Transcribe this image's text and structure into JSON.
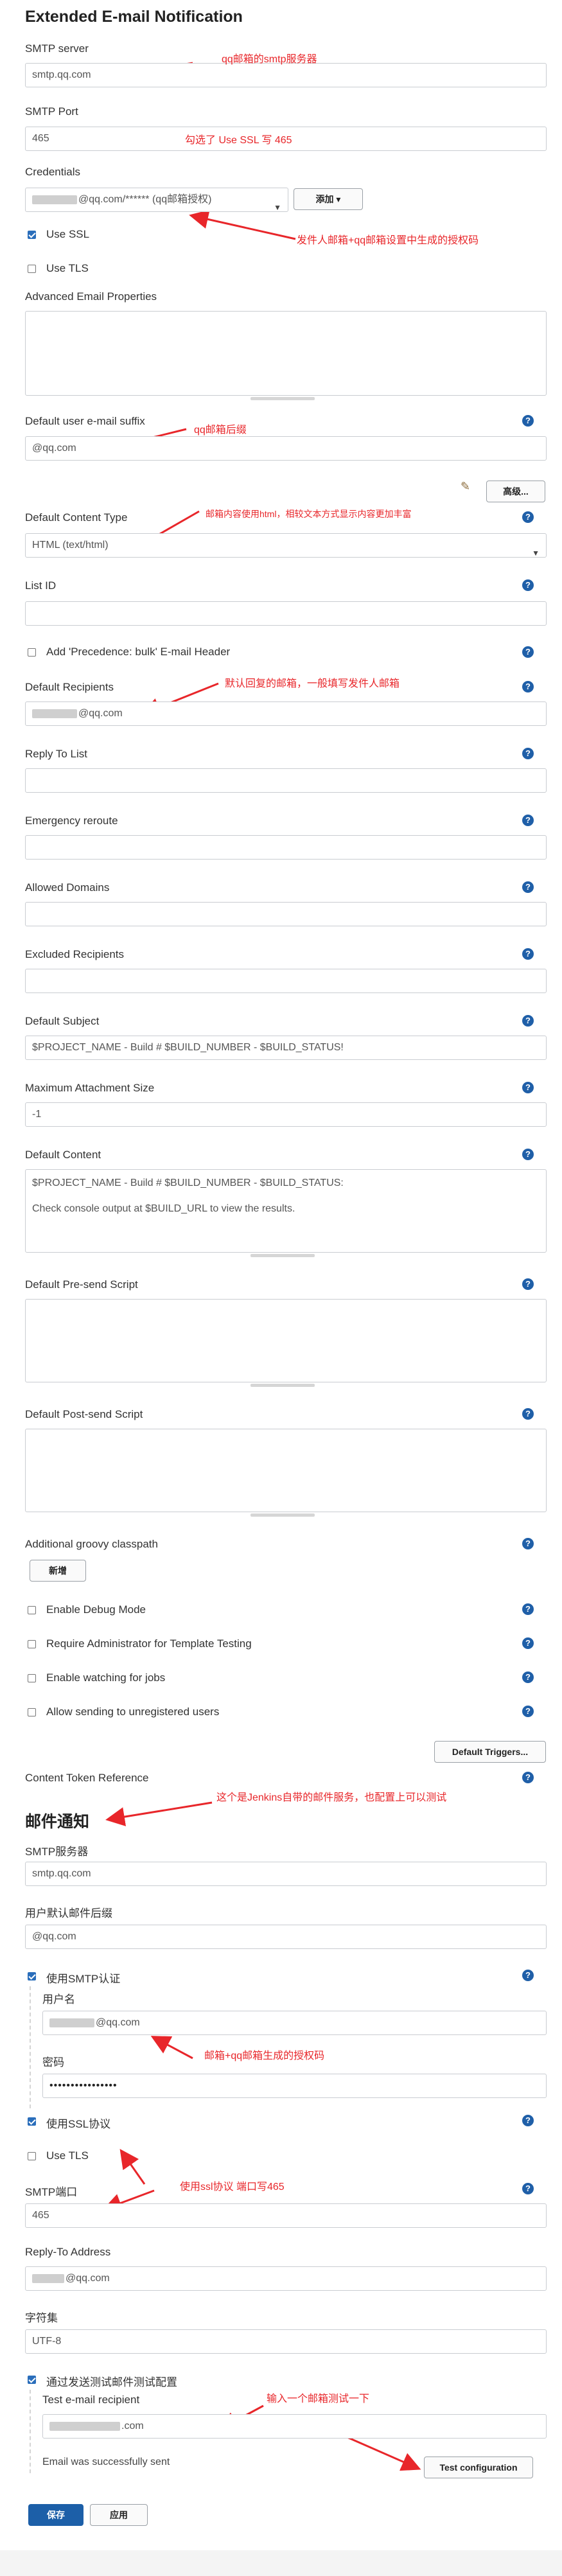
{
  "title": "Extended E-mail Notification",
  "smtp_server": {
    "label": "SMTP server",
    "value": "smtp.qq.com",
    "note": "qq邮箱的smtp服务器"
  },
  "smtp_port": {
    "label": "SMTP Port",
    "value": "465",
    "note": "勾选了 Use SSL 写 465"
  },
  "credentials": {
    "label": "Credentials",
    "value": "@qq.com/****** (qq邮箱授权)",
    "add_button": "添加",
    "note": "发件人邮箱+qq邮箱设置中生成的授权码"
  },
  "use_ssl": {
    "label": "Use SSL",
    "checked": true
  },
  "use_tls": {
    "label": "Use TLS",
    "checked": false
  },
  "advanced_props": {
    "label": "Advanced Email Properties"
  },
  "default_suffix": {
    "label": "Default user e-mail suffix",
    "value": "@qq.com",
    "note": "qq邮箱后缀"
  },
  "advanced_button": "高级...",
  "content_type": {
    "label": "Default Content Type",
    "value": "HTML (text/html)",
    "note": "邮箱内容使用html，相较文本方式显示内容更加丰富"
  },
  "list_id": {
    "label": "List ID"
  },
  "precedence": {
    "label": "Add 'Precedence: bulk' E-mail Header",
    "checked": false
  },
  "default_recipients": {
    "label": "Default Recipients",
    "value": "@qq.com",
    "note": "默认回复的邮箱，一般填写发件人邮箱"
  },
  "reply_to_list": {
    "label": "Reply To List"
  },
  "emergency_reroute": {
    "label": "Emergency reroute"
  },
  "allowed_domains": {
    "label": "Allowed Domains"
  },
  "excluded_recipients": {
    "label": "Excluded Recipients"
  },
  "default_subject": {
    "label": "Default Subject",
    "value": "$PROJECT_NAME - Build # $BUILD_NUMBER - $BUILD_STATUS!"
  },
  "max_attachment": {
    "label": "Maximum Attachment Size",
    "value": "-1"
  },
  "default_content": {
    "label": "Default Content",
    "line1": "$PROJECT_NAME - Build # $BUILD_NUMBER - $BUILD_STATUS:",
    "line2": "Check console output at $BUILD_URL to view the results."
  },
  "presend_script": {
    "label": "Default Pre-send Script"
  },
  "postsend_script": {
    "label": "Default Post-send Script"
  },
  "groovy_classpath": {
    "label": "Additional groovy classpath",
    "add_button": "新增"
  },
  "debug_mode": {
    "label": "Enable Debug Mode"
  },
  "require_admin": {
    "label": "Require Administrator for Template Testing"
  },
  "watching_jobs": {
    "label": "Enable watching for jobs"
  },
  "unregistered_users": {
    "label": "Allow sending to unregistered users"
  },
  "default_triggers_button": "Default Triggers...",
  "content_token_ref": {
    "label": "Content Token Reference",
    "note": "这个是Jenkins自带的邮件服务，也配置上可以测试"
  },
  "mail_title": "邮件通知",
  "mail_smtp_server": {
    "label": "SMTP服务器",
    "value": "smtp.qq.com"
  },
  "mail_suffix": {
    "label": "用户默认邮件后缀",
    "value": "@qq.com"
  },
  "use_smtp_auth": {
    "label": "使用SMTP认证",
    "checked": true
  },
  "username": {
    "label": "用户名",
    "value": "@qq.com"
  },
  "password": {
    "label": "密码",
    "value": "••••••••••••••••",
    "note": "邮箱+qq邮箱生成的授权码"
  },
  "mail_use_ssl": {
    "label": "使用SSL协议",
    "checked": true
  },
  "mail_use_tls": {
    "label": "Use TLS",
    "checked": false
  },
  "mail_smtp_port": {
    "label": "SMTP端口",
    "value": "465",
    "note": "使用ssl协议 端口写465"
  },
  "reply_to": {
    "label": "Reply-To Address",
    "value": "@qq.com"
  },
  "charset": {
    "label": "字符集",
    "value": "UTF-8"
  },
  "test_send": {
    "label": "通过发送测试邮件测试配置",
    "checked": true
  },
  "test_recipient": {
    "label": "Test e-mail recipient",
    "value": ".com",
    "note": "输入一个邮箱测试一下"
  },
  "success_msg": "Email was successfully sent",
  "test_config_button": "Test configuration",
  "save_button": "保存",
  "apply_button": "应用",
  "colors": {
    "accent": "#1f5fa8",
    "annotation": "#e8262a",
    "save": "#1c5fa8"
  }
}
